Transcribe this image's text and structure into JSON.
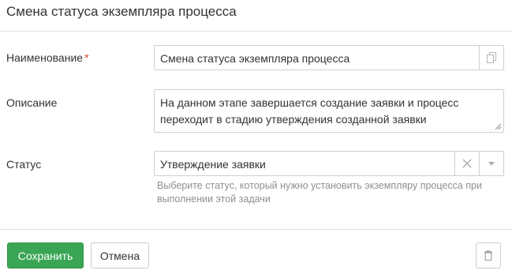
{
  "header": {
    "title": "Смена статуса экземпляра процесса"
  },
  "fields": {
    "name": {
      "label": "Наименование",
      "required_mark": "*",
      "value": "Смена статуса экземпляра процесса",
      "copy_icon": "copy-icon"
    },
    "description": {
      "label": "Описание",
      "value": "На данном этапе завершается создание заявки и процесс переходит в стадию утверждения созданной заявки"
    },
    "status": {
      "label": "Статус",
      "value": "Утверждение заявки",
      "clear_icon": "close-icon",
      "dropdown_icon": "caret-down-icon",
      "hint": "Выберите статус, который нужно установить экземпляру процесса при выполнении этой задачи"
    }
  },
  "footer": {
    "save_label": "Сохранить",
    "cancel_label": "Отмена",
    "delete_icon": "trash-icon"
  },
  "colors": {
    "accent": "#3aa655",
    "required": "#e53935",
    "hint_text": "#8f8f8f",
    "border": "#cfcfcf"
  }
}
